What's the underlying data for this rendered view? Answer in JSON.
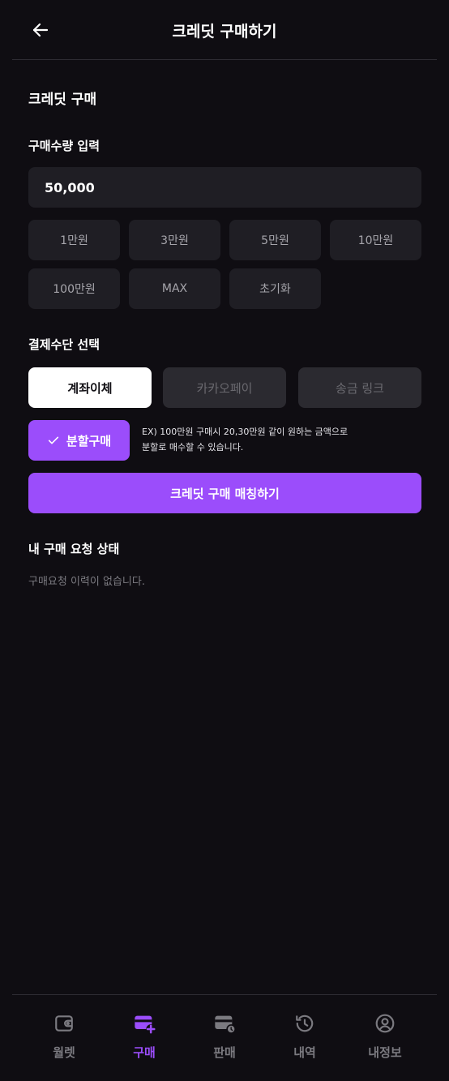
{
  "header": {
    "title": "크레딧 구매하기"
  },
  "purchase": {
    "section_title": "크레딧 구매",
    "quantity_label": "구매수량 입력",
    "amount_value": "50,000",
    "chips": [
      "1만원",
      "3만원",
      "5만원",
      "10만원",
      "100만원",
      "MAX",
      "초기화"
    ]
  },
  "payment": {
    "label": "결제수단 선택",
    "methods": [
      "계좌이체",
      "카카오페이",
      "송금 링크"
    ],
    "selected": "계좌이체"
  },
  "split": {
    "label": "분할구매",
    "note_line1": "EX) 100만원 구매시 20,30만원 같이 원하는 금액으로",
    "note_line2": "분할로 매수할 수 있습니다."
  },
  "match_button": "크레딧 구매 매칭하기",
  "status": {
    "title": "내 구매 요청 상태",
    "empty": "구매요청 이력이 없습니다."
  },
  "nav": {
    "items": [
      {
        "label": "월렛",
        "icon": "wallet-icon"
      },
      {
        "label": "구매",
        "icon": "card-plus-icon"
      },
      {
        "label": "판매",
        "icon": "card-clock-icon"
      },
      {
        "label": "내역",
        "icon": "history-icon"
      },
      {
        "label": "내정보",
        "icon": "user-icon"
      }
    ],
    "active": "구매"
  },
  "colors": {
    "background": "#0f0d12",
    "surface": "#1f1e24",
    "accent": "#9b4dfb",
    "muted": "#7b7a80"
  }
}
